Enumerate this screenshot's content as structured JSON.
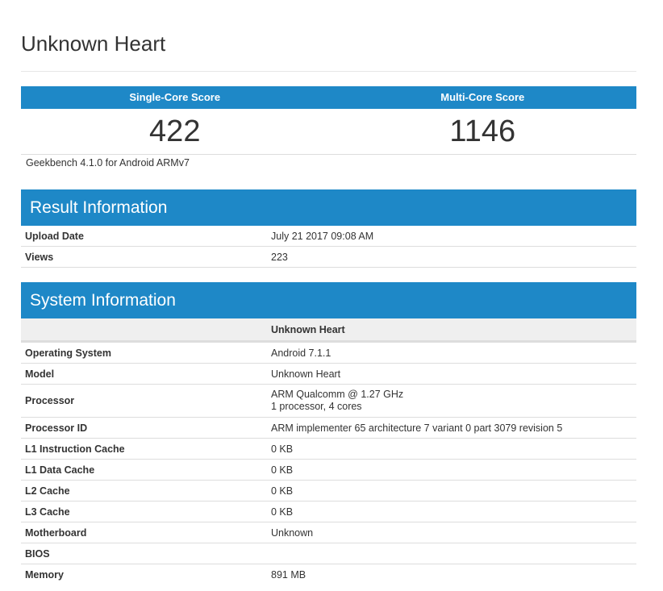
{
  "title": "Unknown Heart",
  "scores": {
    "single_label": "Single-Core Score",
    "single_value": "422",
    "multi_label": "Multi-Core Score",
    "multi_value": "1146"
  },
  "platform": "Geekbench 4.1.0 for Android ARMv7",
  "result_info": {
    "heading": "Result Information",
    "rows": [
      {
        "label": "Upload Date",
        "value": "July 21 2017 09:08 AM"
      },
      {
        "label": "Views",
        "value": "223"
      }
    ]
  },
  "system_info": {
    "heading": "System Information",
    "device_column": "Unknown Heart",
    "rows": [
      {
        "label": "Operating System",
        "value": "Android 7.1.1"
      },
      {
        "label": "Model",
        "value": "Unknown Heart"
      },
      {
        "label": "Processor",
        "value": "ARM Qualcomm @ 1.27 GHz",
        "value2": "1 processor, 4 cores"
      },
      {
        "label": "Processor ID",
        "value": "ARM implementer 65 architecture 7 variant 0 part 3079 revision 5"
      },
      {
        "label": "L1 Instruction Cache",
        "value": "0 KB"
      },
      {
        "label": "L1 Data Cache",
        "value": "0 KB"
      },
      {
        "label": "L2 Cache",
        "value": "0 KB"
      },
      {
        "label": "L3 Cache",
        "value": "0 KB"
      },
      {
        "label": "Motherboard",
        "value": "Unknown"
      },
      {
        "label": "BIOS",
        "value": ""
      },
      {
        "label": "Memory",
        "value": "891 MB"
      }
    ]
  }
}
